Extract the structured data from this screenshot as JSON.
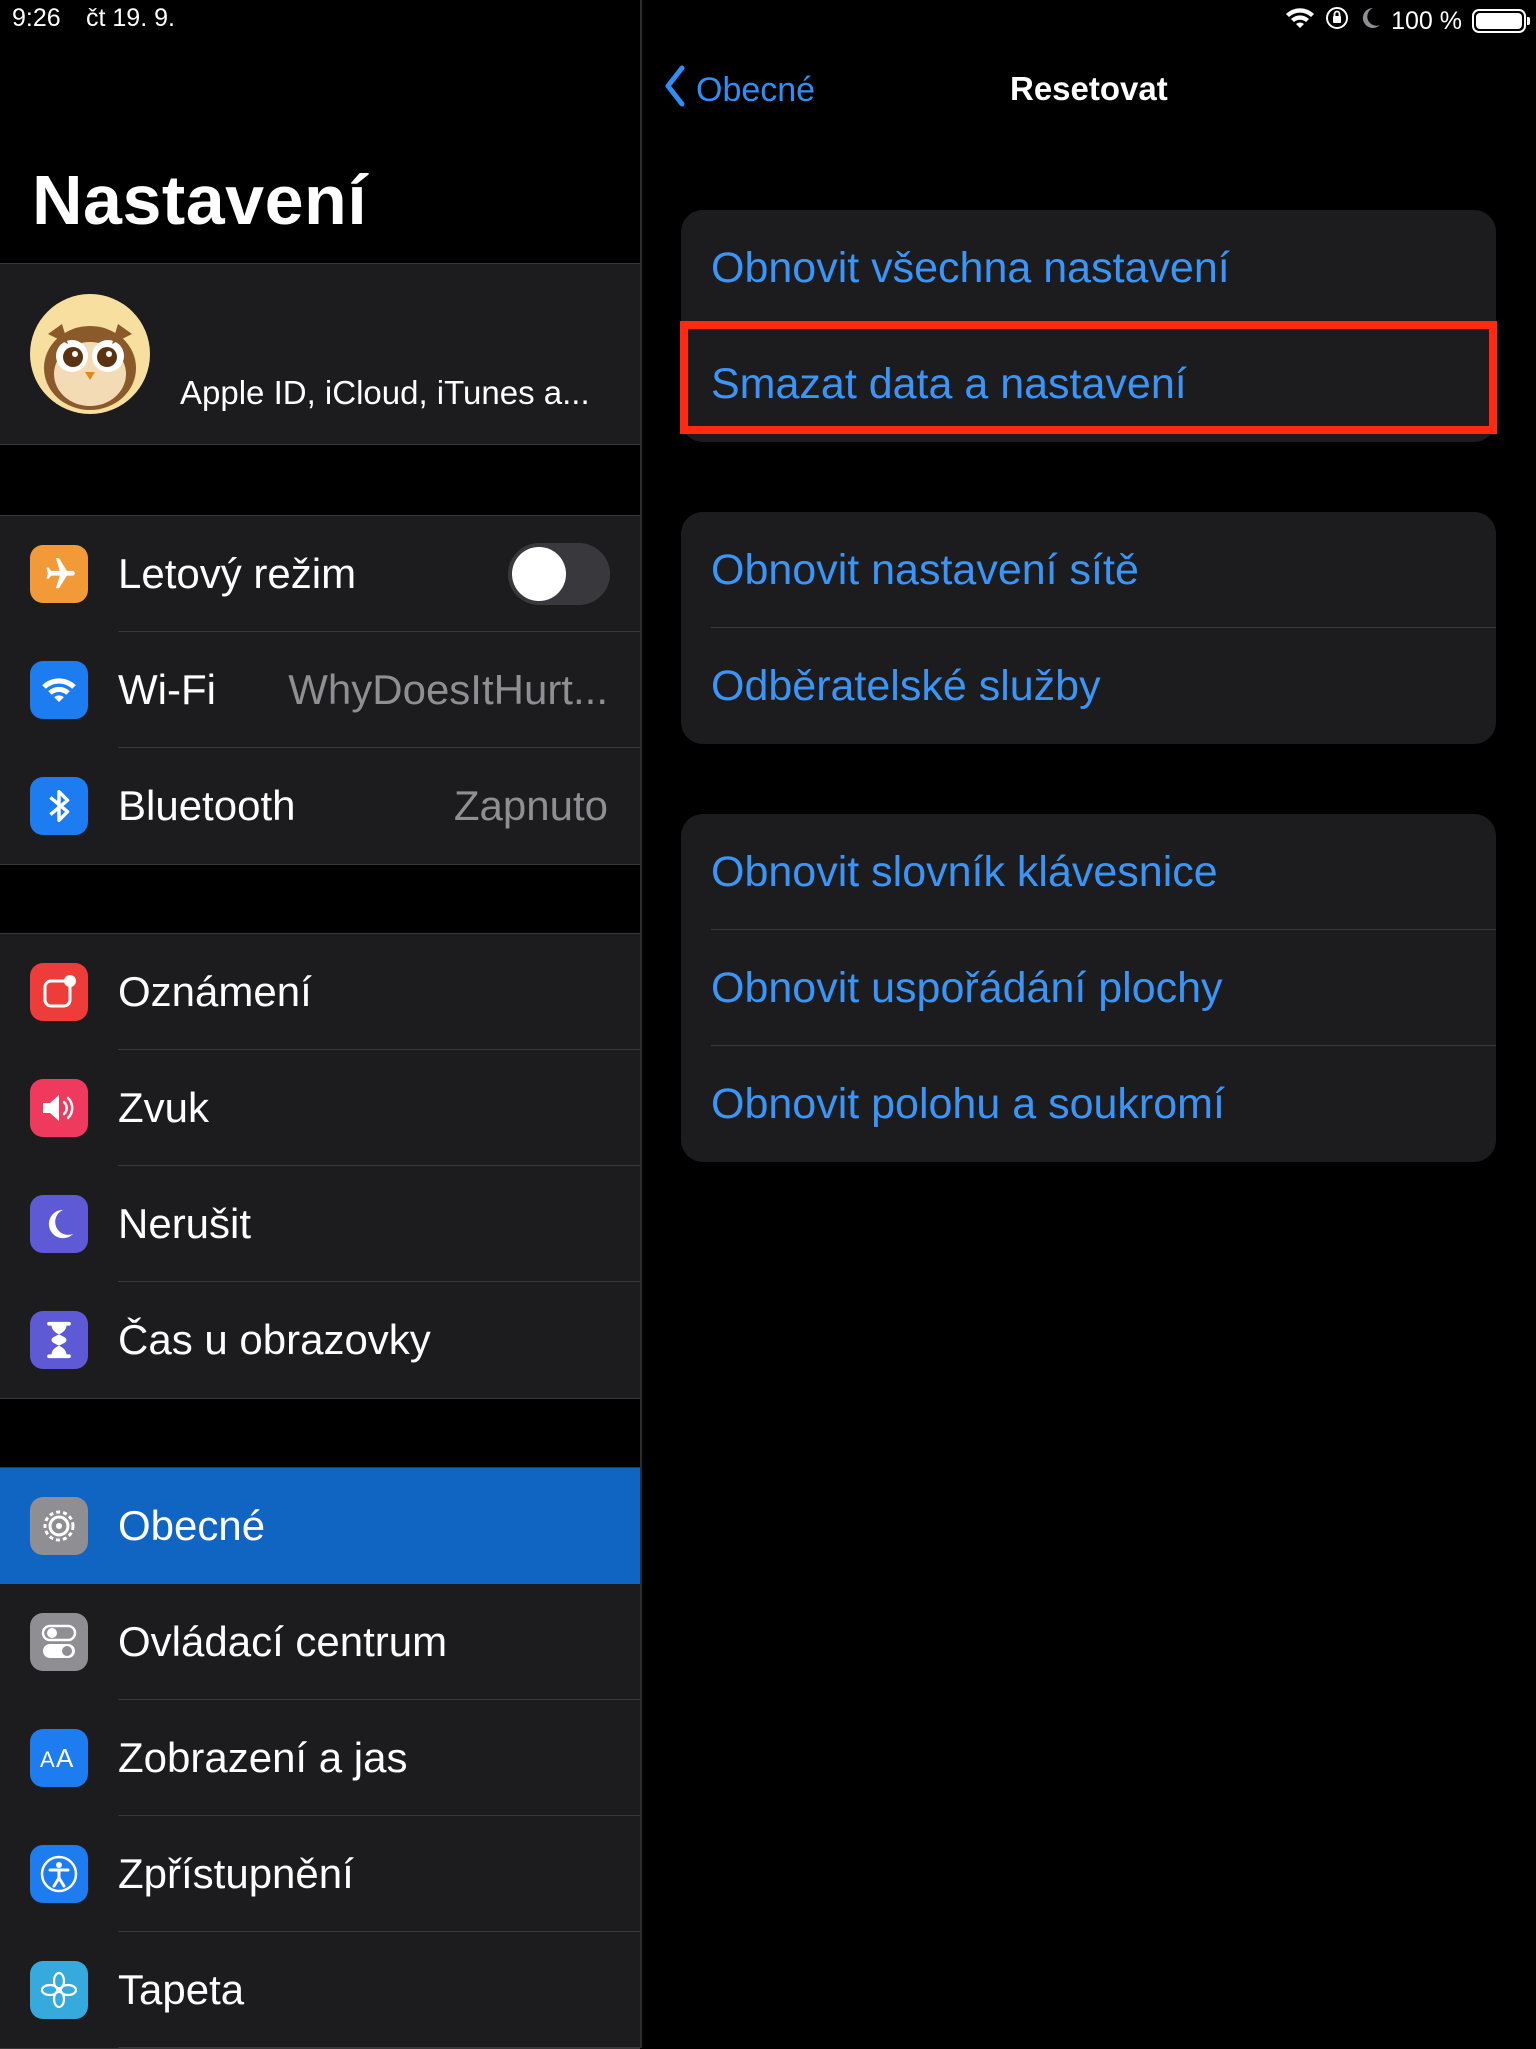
{
  "status_bar": {
    "time": "9:26",
    "date": "čt 19. 9.",
    "battery": "100 %",
    "icons": [
      "wifi-icon",
      "orientation-lock-icon",
      "moon-icon",
      "battery-icon"
    ]
  },
  "sidebar": {
    "title": "Nastavení",
    "profile": {
      "subtitle": "Apple ID, iCloud, iTunes a..."
    },
    "group1": [
      {
        "label": "Letový režim",
        "icon": "airplane-icon",
        "color": "#f29a38",
        "toggle": false
      },
      {
        "label": "Wi-Fi",
        "value": "WhyDoesItHurt...",
        "icon": "wifi-icon",
        "color": "#1c7cf0"
      },
      {
        "label": "Bluetooth",
        "value": "Zapnuto",
        "icon": "bluetooth-icon",
        "color": "#1c7cf0"
      }
    ],
    "group2": [
      {
        "label": "Oznámení",
        "icon": "notifications-icon",
        "color": "#ee3c3a"
      },
      {
        "label": "Zvuk",
        "icon": "speaker-icon",
        "color": "#ef3a5d"
      },
      {
        "label": "Nerušit",
        "icon": "moon-icon",
        "color": "#5e5ad6"
      },
      {
        "label": "Čas u obrazovky",
        "icon": "hourglass-icon",
        "color": "#5e5ad6"
      }
    ],
    "group3": [
      {
        "label": "Obecné",
        "icon": "gear-icon",
        "color": "#8e8e93",
        "selected": true
      },
      {
        "label": "Ovládací centrum",
        "icon": "toggles-icon",
        "color": "#8e8e93"
      },
      {
        "label": "Zobrazení a jas",
        "icon": "text-size-icon",
        "color": "#1c7cf0"
      },
      {
        "label": "Zpřístupnění",
        "icon": "accessibility-icon",
        "color": "#1c7cf0"
      },
      {
        "label": "Tapeta",
        "icon": "flower-icon",
        "color": "#36aadc"
      }
    ]
  },
  "detail": {
    "back_label": "Obecné",
    "title": "Resetovat",
    "groups": [
      [
        "Obnovit všechna nastavení",
        "Smazat data a nastavení"
      ],
      [
        "Obnovit nastavení sítě",
        "Odběratelské služby"
      ],
      [
        "Obnovit slovník klávesnice",
        "Obnovit uspořádání plochy",
        "Obnovit polohu a soukromí"
      ]
    ],
    "highlighted_item": "Smazat data a nastavení",
    "highlight_color": "#ff2a0f",
    "link_color": "#3a95f7"
  }
}
